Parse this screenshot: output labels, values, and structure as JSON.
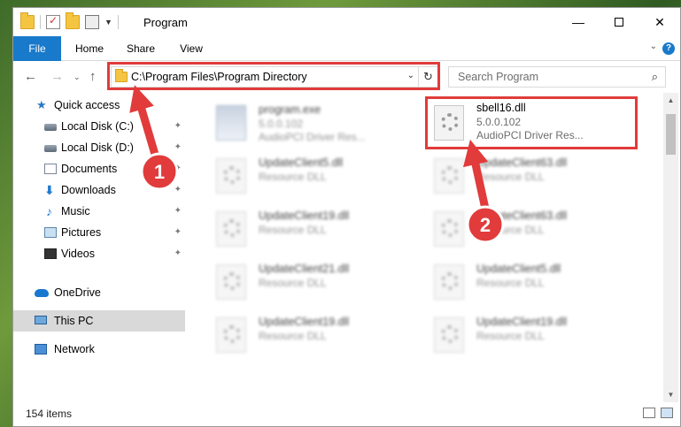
{
  "window": {
    "title": "Program",
    "controls": {
      "minimize": "—",
      "maximize": "",
      "close": "✕"
    }
  },
  "ribbon": {
    "tabs": [
      "File",
      "Home",
      "Share",
      "View"
    ],
    "expand_glyph": "⌄",
    "help_glyph": "?"
  },
  "nav": {
    "back": "←",
    "forward": "→",
    "recent": "⌄",
    "up": "↑"
  },
  "address": {
    "path": "C:\\Program Files\\Program Directory",
    "dropdown_glyph": "⌄",
    "refresh_glyph": "↻"
  },
  "search": {
    "placeholder": "Search Program",
    "icon_glyph": "⌕"
  },
  "sidebar": {
    "items": [
      {
        "label": "Quick access",
        "icon": "star-icon",
        "glyph": "★",
        "pinned": false
      },
      {
        "label": "Local Disk (C:)",
        "icon": "disk-icon",
        "pinned": true
      },
      {
        "label": "Local Disk (D:)",
        "icon": "disk-icon",
        "pinned": true
      },
      {
        "label": "Documents",
        "icon": "documents-icon",
        "pinned": true
      },
      {
        "label": "Downloads",
        "icon": "downloads-icon",
        "glyph": "⬇",
        "pinned": true
      },
      {
        "label": "Music",
        "icon": "music-icon",
        "glyph": "♪",
        "pinned": true
      },
      {
        "label": "Pictures",
        "icon": "pictures-icon",
        "pinned": true
      },
      {
        "label": "Videos",
        "icon": "videos-icon",
        "pinned": true
      },
      {
        "label": "OneDrive",
        "icon": "onedrive-icon",
        "pinned": false
      },
      {
        "label": "This PC",
        "icon": "this-pc-icon",
        "pinned": false,
        "selected": true
      },
      {
        "label": "Network",
        "icon": "network-icon",
        "pinned": false
      }
    ],
    "pin_glyph": "📌"
  },
  "files": [
    {
      "name": "program.exe",
      "line2": "5.0.0.102",
      "line3": "AudioPCI Driver Res...",
      "blurred": true
    },
    {
      "name": "sbell16.dll",
      "line2": "5.0.0.102",
      "line3": "AudioPCI Driver Res...",
      "blurred": false,
      "highlighted": true
    },
    {
      "name": "UpdateClient5.dll",
      "line2": "Resource DLL",
      "blurred": true
    },
    {
      "name": "UpdateClient63.dll",
      "line2": "Resource DLL",
      "blurred": true
    },
    {
      "name": "UpdateClient19.dll",
      "line2": "Resource DLL",
      "blurred": true
    },
    {
      "name": "UpdateClient63.dll",
      "line2": "Resource DLL",
      "blurred": true
    },
    {
      "name": "UpdateClient21.dll",
      "line2": "Resource DLL",
      "blurred": true
    },
    {
      "name": "UpdateClient5.dll",
      "line2": "Resource DLL",
      "blurred": true
    },
    {
      "name": "UpdateClient19.dll",
      "line2": "Resource DLL",
      "blurred": true
    },
    {
      "name": "UpdateClient19.dll",
      "line2": "Resource DLL",
      "blurred": true
    }
  ],
  "status": {
    "item_count": "154 items"
  },
  "annotations": {
    "step1": "1",
    "step2": "2",
    "color": "#e13b3b"
  }
}
